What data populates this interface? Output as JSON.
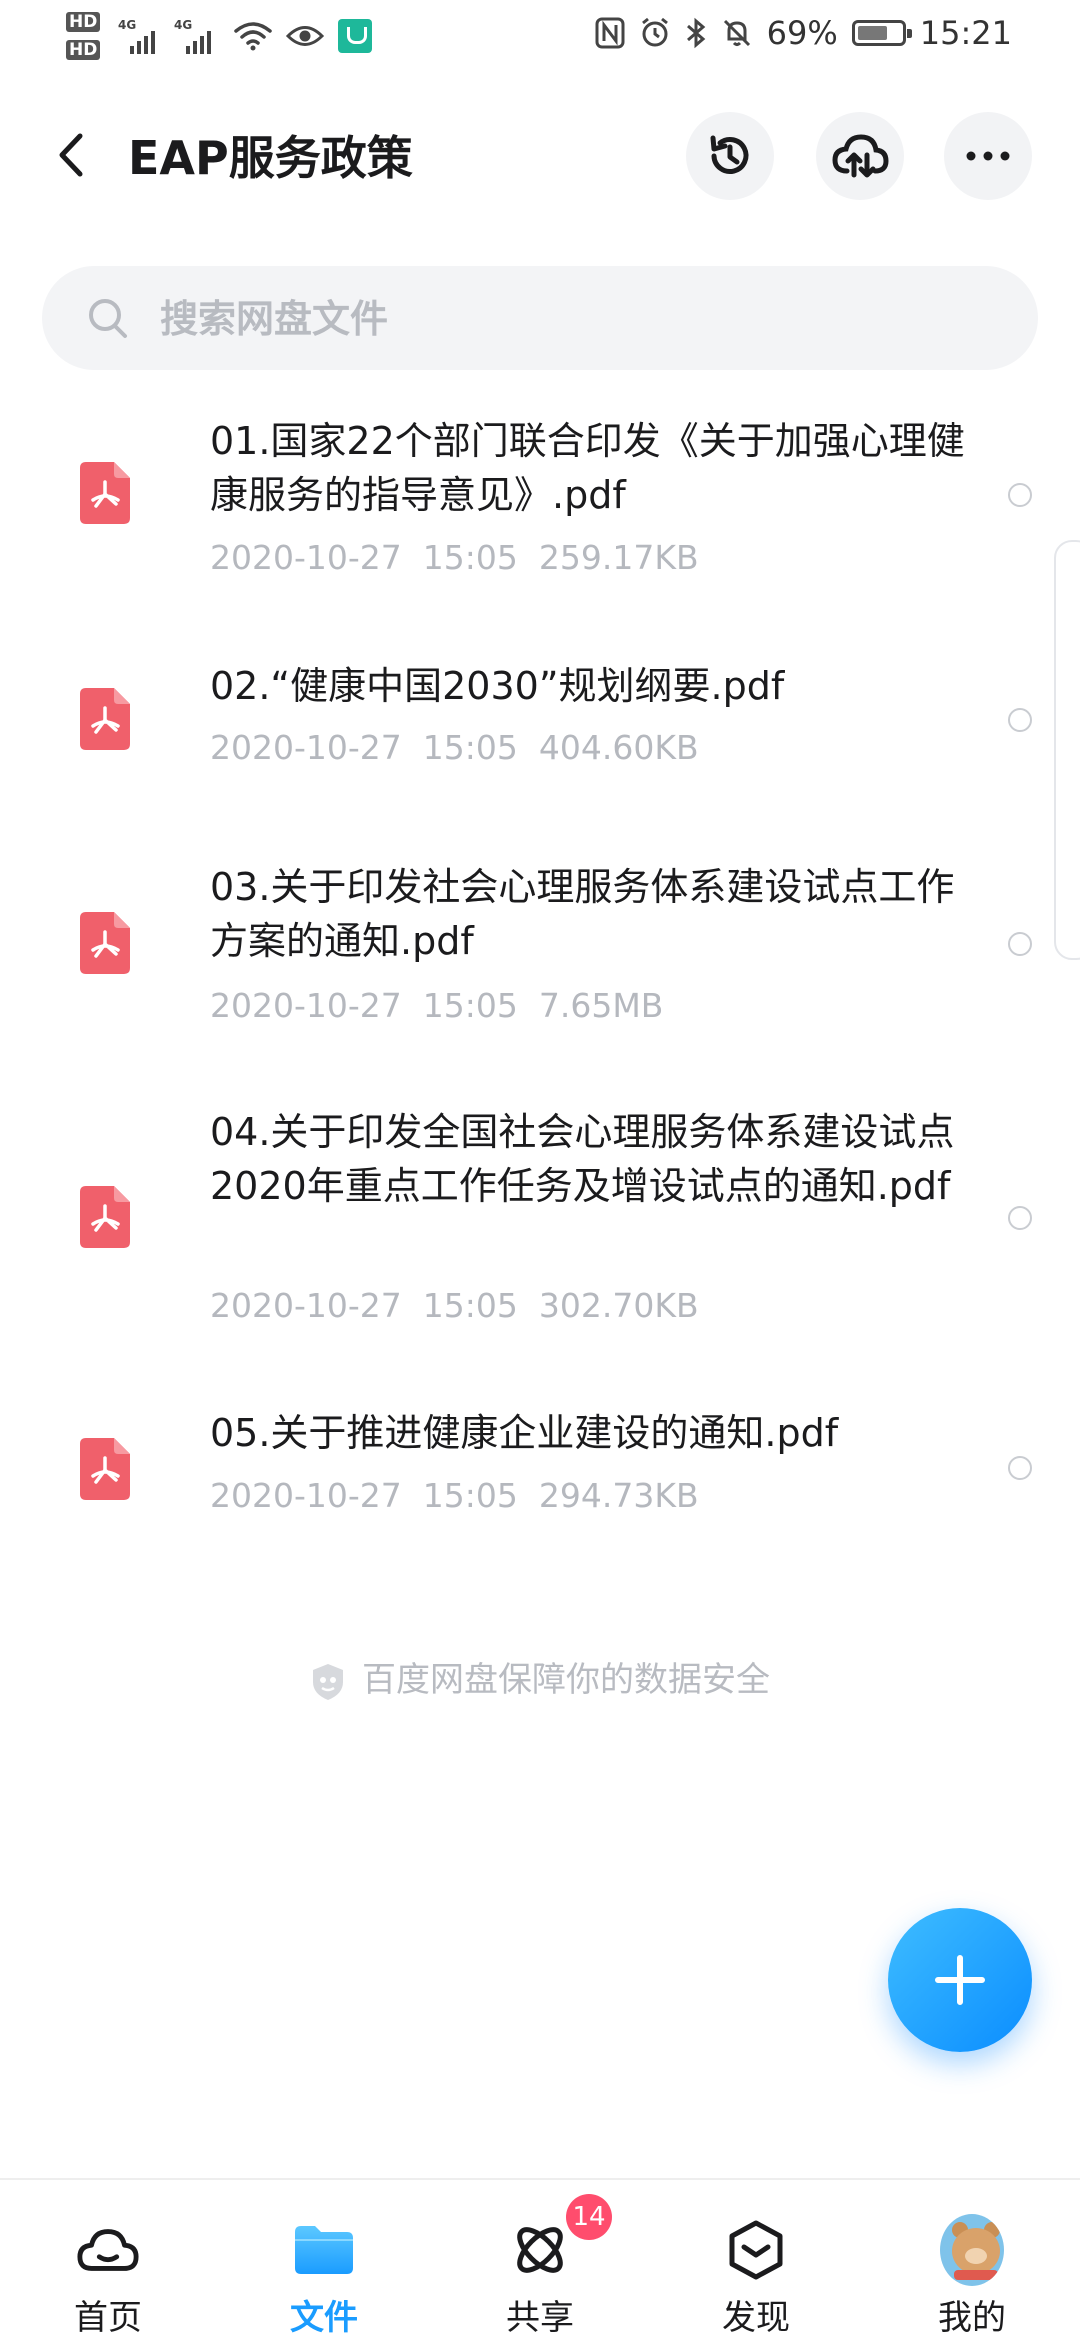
{
  "status_bar": {
    "hd1": "HD",
    "hd2": "HD",
    "signal1": "4G",
    "signal2": "4G",
    "battery_percent": "69%",
    "time": "15:21"
  },
  "header": {
    "title": "EAP服务政策"
  },
  "search": {
    "placeholder": "搜索网盘文件"
  },
  "files": [
    {
      "name": "01.国家22个部门联合印发《关于加强心理健康服务的指导意见》.pdf",
      "date": "2020-10-27",
      "time": "15:05",
      "size": "259.17KB"
    },
    {
      "name": "02.“健康中国2030”规划纲要.pdf",
      "date": "2020-10-27",
      "time": "15:05",
      "size": "404.60KB"
    },
    {
      "name": "03.关于印发社会心理服务体系建设试点工作方案的通知.pdf",
      "date": "2020-10-27",
      "time": "15:05",
      "size": "7.65MB"
    },
    {
      "name": "04.关于印发全国社会心理服务体系建设试点2020年重点工作任务及增设试点的通知.pdf",
      "date": "2020-10-27",
      "time": "15:05",
      "size": "302.70KB"
    },
    {
      "name": "05.关于推进健康企业建设的通知.pdf",
      "date": "2020-10-27",
      "time": "15:05",
      "size": "294.73KB"
    }
  ],
  "security_note": "百度网盘保障你的数据安全",
  "bottom_nav": {
    "items": [
      {
        "label": "首页"
      },
      {
        "label": "文件"
      },
      {
        "label": "共享"
      },
      {
        "label": "发现"
      },
      {
        "label": "我的"
      }
    ],
    "share_badge": "14"
  },
  "colors": {
    "accent": "#1a9cff",
    "pdf_red": "#f0606b",
    "badge": "#ff4d6d"
  }
}
